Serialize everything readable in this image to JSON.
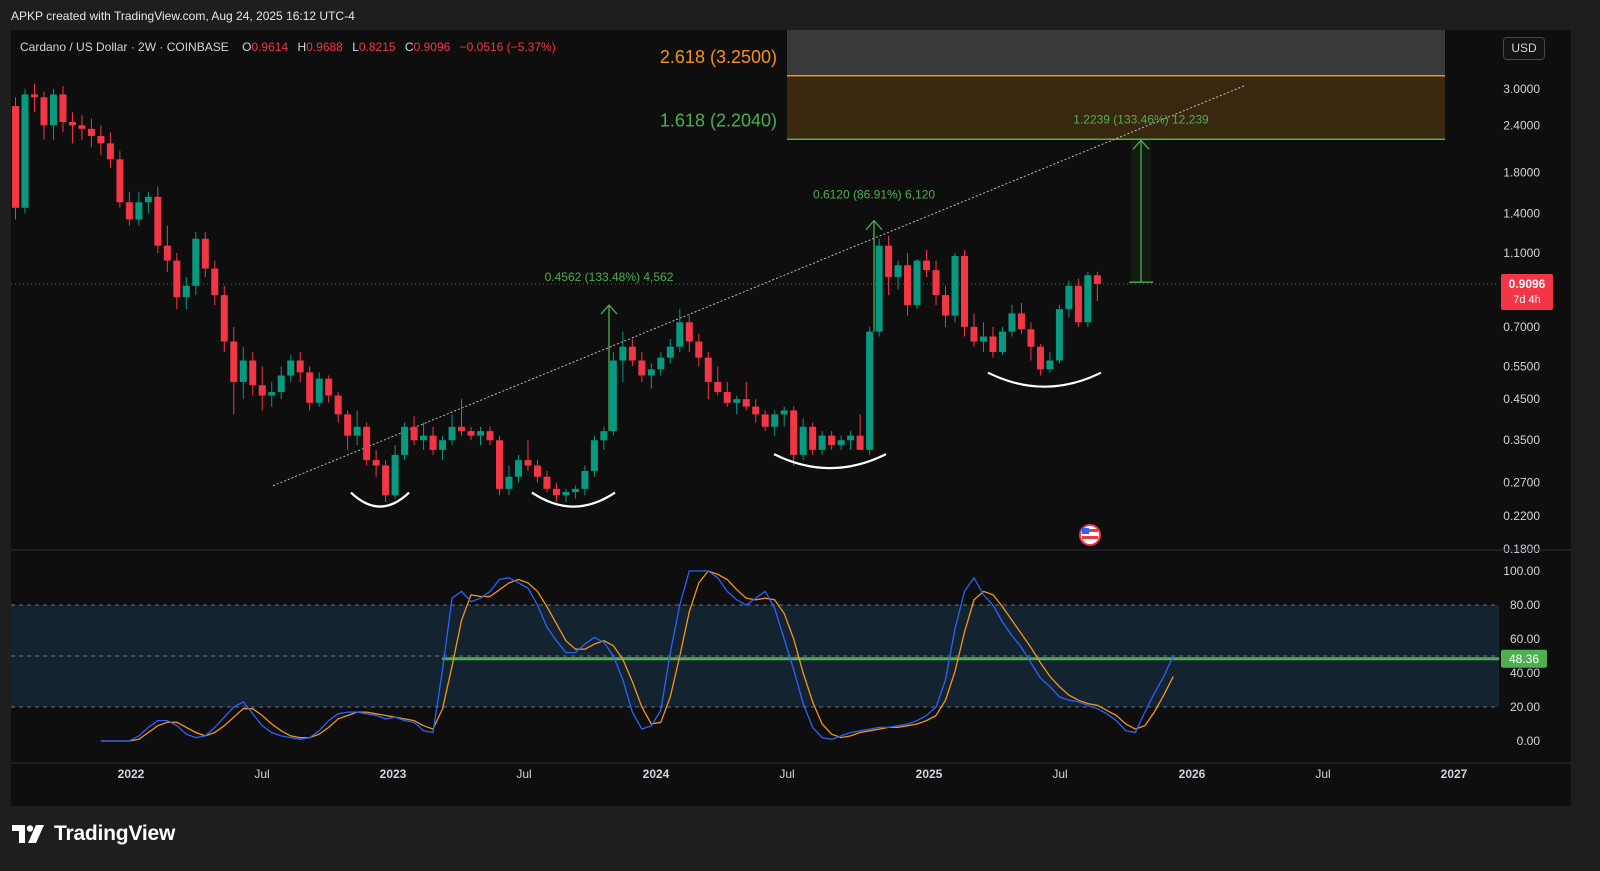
{
  "header": {
    "caption": "APKP created with TradingView.com, Aug 24, 2025 16:12 UTC-4",
    "symbol": "Cardano / US Dollar · 2W · COINBASE",
    "o_label": "O",
    "o_value": "0.9614",
    "h_label": "H",
    "h_value": "0.9688",
    "l_label": "L",
    "l_value": "0.8215",
    "c_label": "C",
    "c_value": "0.9096",
    "change": "−0.0516 (−5.37%)",
    "currency_button": "USD"
  },
  "branding": {
    "name": "TradingView"
  },
  "colors": {
    "up": "#089981",
    "down": "#f23645",
    "stoch_k": "#2962ff",
    "stoch_d": "#f7931a",
    "fib_2618": "#f7931a",
    "fib_1618": "#4caf50",
    "projection": "#4caf50"
  },
  "chart_data": [
    {
      "type": "candlestick",
      "title": "Cardano / US Dollar · 2W · COINBASE",
      "scale": "log",
      "ylim": [
        0.18,
        4.3
      ],
      "y_ticks": [
        "3.0000",
        "2.4000",
        "1.8000",
        "1.4000",
        "1.1000",
        "0.7000",
        "0.5500",
        "0.4500",
        "0.3500",
        "0.2700",
        "0.2200",
        "0.1800"
      ],
      "last_price": "0.9096",
      "last_price_countdown": "7d 4h",
      "x_ticks": [
        "2022",
        "Jul",
        "2023",
        "Jul",
        "2024",
        "Jul",
        "2025",
        "Jul",
        "2026",
        "Jul",
        "2027"
      ],
      "candles": [
        [
          2.7,
          2.85,
          1.35,
          1.45
        ],
        [
          1.45,
          3.0,
          1.4,
          2.9
        ],
        [
          2.9,
          3.1,
          2.6,
          2.85
        ],
        [
          2.85,
          2.95,
          2.2,
          2.4
        ],
        [
          2.4,
          3.0,
          2.2,
          2.9
        ],
        [
          2.9,
          3.05,
          2.3,
          2.45
        ],
        [
          2.45,
          2.6,
          2.15,
          2.4
        ],
        [
          2.4,
          2.55,
          2.2,
          2.35
        ],
        [
          2.35,
          2.5,
          2.1,
          2.25
        ],
        [
          2.25,
          2.4,
          2.0,
          2.15
        ],
        [
          2.15,
          2.3,
          1.85,
          1.95
        ],
        [
          1.95,
          2.05,
          1.45,
          1.5
        ],
        [
          1.5,
          1.6,
          1.3,
          1.35
        ],
        [
          1.35,
          1.6,
          1.3,
          1.5
        ],
        [
          1.5,
          1.6,
          1.4,
          1.55
        ],
        [
          1.55,
          1.65,
          1.1,
          1.15
        ],
        [
          1.15,
          1.3,
          0.98,
          1.05
        ],
        [
          1.05,
          1.1,
          0.78,
          0.84
        ],
        [
          0.84,
          0.95,
          0.78,
          0.9
        ],
        [
          0.9,
          1.25,
          0.85,
          1.2
        ],
        [
          1.2,
          1.25,
          0.95,
          1.0
        ],
        [
          1.0,
          1.05,
          0.8,
          0.85
        ],
        [
          0.85,
          0.9,
          0.6,
          0.64
        ],
        [
          0.64,
          0.7,
          0.41,
          0.5
        ],
        [
          0.5,
          0.62,
          0.45,
          0.57
        ],
        [
          0.57,
          0.6,
          0.46,
          0.49
        ],
        [
          0.49,
          0.55,
          0.42,
          0.46
        ],
        [
          0.46,
          0.5,
          0.43,
          0.47
        ],
        [
          0.47,
          0.55,
          0.45,
          0.52
        ],
        [
          0.52,
          0.59,
          0.5,
          0.57
        ],
        [
          0.57,
          0.6,
          0.5,
          0.53
        ],
        [
          0.53,
          0.55,
          0.42,
          0.44
        ],
        [
          0.44,
          0.53,
          0.43,
          0.51
        ],
        [
          0.51,
          0.52,
          0.44,
          0.46
        ],
        [
          0.46,
          0.47,
          0.39,
          0.41
        ],
        [
          0.41,
          0.42,
          0.33,
          0.36
        ],
        [
          0.36,
          0.42,
          0.34,
          0.38
        ],
        [
          0.38,
          0.39,
          0.3,
          0.31
        ],
        [
          0.31,
          0.33,
          0.28,
          0.3
        ],
        [
          0.3,
          0.31,
          0.24,
          0.25
        ],
        [
          0.25,
          0.34,
          0.245,
          0.32
        ],
        [
          0.32,
          0.39,
          0.31,
          0.38
        ],
        [
          0.38,
          0.405,
          0.34,
          0.35
        ],
        [
          0.35,
          0.39,
          0.33,
          0.36
        ],
        [
          0.36,
          0.38,
          0.32,
          0.33
        ],
        [
          0.33,
          0.36,
          0.31,
          0.35
        ],
        [
          0.35,
          0.41,
          0.34,
          0.38
        ],
        [
          0.38,
          0.45,
          0.36,
          0.37
        ],
        [
          0.37,
          0.38,
          0.35,
          0.36
        ],
        [
          0.36,
          0.38,
          0.34,
          0.37
        ],
        [
          0.37,
          0.38,
          0.34,
          0.35
        ],
        [
          0.35,
          0.36,
          0.25,
          0.26
        ],
        [
          0.26,
          0.3,
          0.25,
          0.28
        ],
        [
          0.28,
          0.32,
          0.27,
          0.31
        ],
        [
          0.31,
          0.35,
          0.29,
          0.3
        ],
        [
          0.3,
          0.31,
          0.27,
          0.28
        ],
        [
          0.28,
          0.29,
          0.255,
          0.26
        ],
        [
          0.26,
          0.27,
          0.24,
          0.25
        ],
        [
          0.25,
          0.26,
          0.24,
          0.255
        ],
        [
          0.255,
          0.265,
          0.245,
          0.26
        ],
        [
          0.26,
          0.3,
          0.25,
          0.29
        ],
        [
          0.29,
          0.36,
          0.28,
          0.35
        ],
        [
          0.35,
          0.38,
          0.33,
          0.37
        ],
        [
          0.37,
          0.6,
          0.36,
          0.57
        ],
        [
          0.57,
          0.68,
          0.5,
          0.62
        ],
        [
          0.62,
          0.65,
          0.55,
          0.57
        ],
        [
          0.57,
          0.6,
          0.5,
          0.52
        ],
        [
          0.52,
          0.56,
          0.48,
          0.54
        ],
        [
          0.54,
          0.6,
          0.52,
          0.58
        ],
        [
          0.58,
          0.65,
          0.56,
          0.62
        ],
        [
          0.62,
          0.78,
          0.6,
          0.72
        ],
        [
          0.72,
          0.75,
          0.6,
          0.64
        ],
        [
          0.64,
          0.67,
          0.55,
          0.58
        ],
        [
          0.58,
          0.6,
          0.45,
          0.5
        ],
        [
          0.5,
          0.55,
          0.46,
          0.47
        ],
        [
          0.47,
          0.5,
          0.43,
          0.44
        ],
        [
          0.44,
          0.46,
          0.41,
          0.45
        ],
        [
          0.45,
          0.5,
          0.42,
          0.43
        ],
        [
          0.43,
          0.45,
          0.39,
          0.41
        ],
        [
          0.41,
          0.42,
          0.37,
          0.38
        ],
        [
          0.38,
          0.42,
          0.36,
          0.41
        ],
        [
          0.41,
          0.43,
          0.38,
          0.42
        ],
        [
          0.42,
          0.43,
          0.3,
          0.32
        ],
        [
          0.32,
          0.4,
          0.31,
          0.38
        ],
        [
          0.38,
          0.39,
          0.32,
          0.33
        ],
        [
          0.33,
          0.37,
          0.32,
          0.36
        ],
        [
          0.36,
          0.37,
          0.33,
          0.34
        ],
        [
          0.34,
          0.36,
          0.33,
          0.35
        ],
        [
          0.35,
          0.37,
          0.33,
          0.36
        ],
        [
          0.36,
          0.41,
          0.34,
          0.33
        ],
        [
          0.33,
          0.7,
          0.32,
          0.68
        ],
        [
          0.68,
          1.2,
          0.66,
          1.15
        ],
        [
          1.15,
          1.22,
          0.85,
          0.95
        ],
        [
          0.95,
          1.05,
          0.88,
          1.02
        ],
        [
          1.02,
          1.1,
          0.75,
          0.8
        ],
        [
          0.8,
          1.06,
          0.78,
          1.05
        ],
        [
          1.05,
          1.12,
          0.95,
          0.99
        ],
        [
          0.99,
          1.05,
          0.8,
          0.85
        ],
        [
          0.85,
          0.9,
          0.7,
          0.75
        ],
        [
          0.75,
          1.1,
          0.72,
          1.08
        ],
        [
          1.08,
          1.12,
          0.66,
          0.7
        ],
        [
          0.7,
          0.76,
          0.62,
          0.64
        ],
        [
          0.64,
          0.72,
          0.6,
          0.66
        ],
        [
          0.66,
          0.7,
          0.58,
          0.6
        ],
        [
          0.6,
          0.7,
          0.59,
          0.68
        ],
        [
          0.68,
          0.8,
          0.66,
          0.76
        ],
        [
          0.76,
          0.81,
          0.67,
          0.69
        ],
        [
          0.69,
          0.72,
          0.57,
          0.62
        ],
        [
          0.62,
          0.63,
          0.52,
          0.54
        ],
        [
          0.54,
          0.6,
          0.53,
          0.57
        ],
        [
          0.57,
          0.8,
          0.56,
          0.78
        ],
        [
          0.78,
          0.93,
          0.74,
          0.9
        ],
        [
          0.9,
          0.94,
          0.7,
          0.72
        ],
        [
          0.72,
          0.98,
          0.7,
          0.96
        ],
        [
          0.96,
          0.98,
          0.82,
          0.91
        ]
      ],
      "fib_levels": [
        {
          "label": "2.618 (3.2500)",
          "value": 3.25
        },
        {
          "label": "1.618 (2.2040)",
          "value": 2.204
        }
      ],
      "measurements": [
        {
          "label": "0.4562 (133.48%) 4,562"
        },
        {
          "label": "0.6120 (86.91%) 6,120"
        },
        {
          "label": "1.2239 (133.46%) 12,239"
        }
      ]
    },
    {
      "type": "line",
      "title": "",
      "ylim": [
        0,
        100
      ],
      "y_ticks": [
        "100.00",
        "80.00",
        "60.00",
        "40.00",
        "20.00",
        "0.00"
      ],
      "band": [
        20,
        80
      ],
      "reference_value": "48.36",
      "series": [
        {
          "values": [
            0,
            0,
            0,
            0,
            3,
            8,
            12,
            12,
            9,
            4,
            2,
            3,
            8,
            14,
            20,
            23,
            16,
            9,
            5,
            3,
            2,
            1,
            2,
            6,
            12,
            16,
            17,
            17,
            16,
            15,
            13,
            14,
            12,
            11,
            6,
            5,
            42,
            84,
            88,
            82,
            84,
            88,
            95,
            96,
            93,
            90,
            80,
            67,
            59,
            52,
            52,
            57,
            61,
            58,
            50,
            36,
            17,
            7,
            9,
            18,
            52,
            80,
            100,
            100,
            100,
            96,
            88,
            83,
            80,
            84,
            88,
            78,
            60,
            42,
            22,
            8,
            2,
            1,
            3,
            5,
            6,
            7,
            8,
            8,
            9,
            10,
            12,
            15,
            20,
            36,
            66,
            88,
            96,
            86,
            80,
            70,
            62,
            55,
            46,
            37,
            32,
            26,
            24,
            23,
            21,
            19,
            16,
            12,
            6,
            5,
            17,
            28,
            38,
            50
          ]
        },
        {
          "values": [
            0,
            0,
            0,
            0,
            1,
            5,
            9,
            11,
            11,
            8,
            5,
            3,
            5,
            9,
            14,
            19,
            19,
            15,
            10,
            6,
            3,
            2,
            2,
            4,
            8,
            13,
            15,
            17,
            17,
            16,
            15,
            14,
            13,
            12,
            9,
            7,
            19,
            44,
            71,
            86,
            85,
            85,
            89,
            93,
            95,
            93,
            88,
            79,
            69,
            59,
            54,
            54,
            57,
            59,
            56,
            48,
            35,
            20,
            10,
            11,
            26,
            50,
            76,
            93,
            100,
            98,
            95,
            89,
            84,
            83,
            84,
            83,
            75,
            60,
            40,
            23,
            10,
            4,
            2,
            3,
            5,
            6,
            7,
            8,
            8,
            9,
            10,
            12,
            15,
            24,
            41,
            64,
            83,
            88,
            86,
            79,
            71,
            63,
            55,
            46,
            38,
            32,
            27,
            24,
            22,
            21,
            18,
            15,
            10,
            7,
            9,
            17,
            27,
            38
          ]
        }
      ]
    }
  ]
}
